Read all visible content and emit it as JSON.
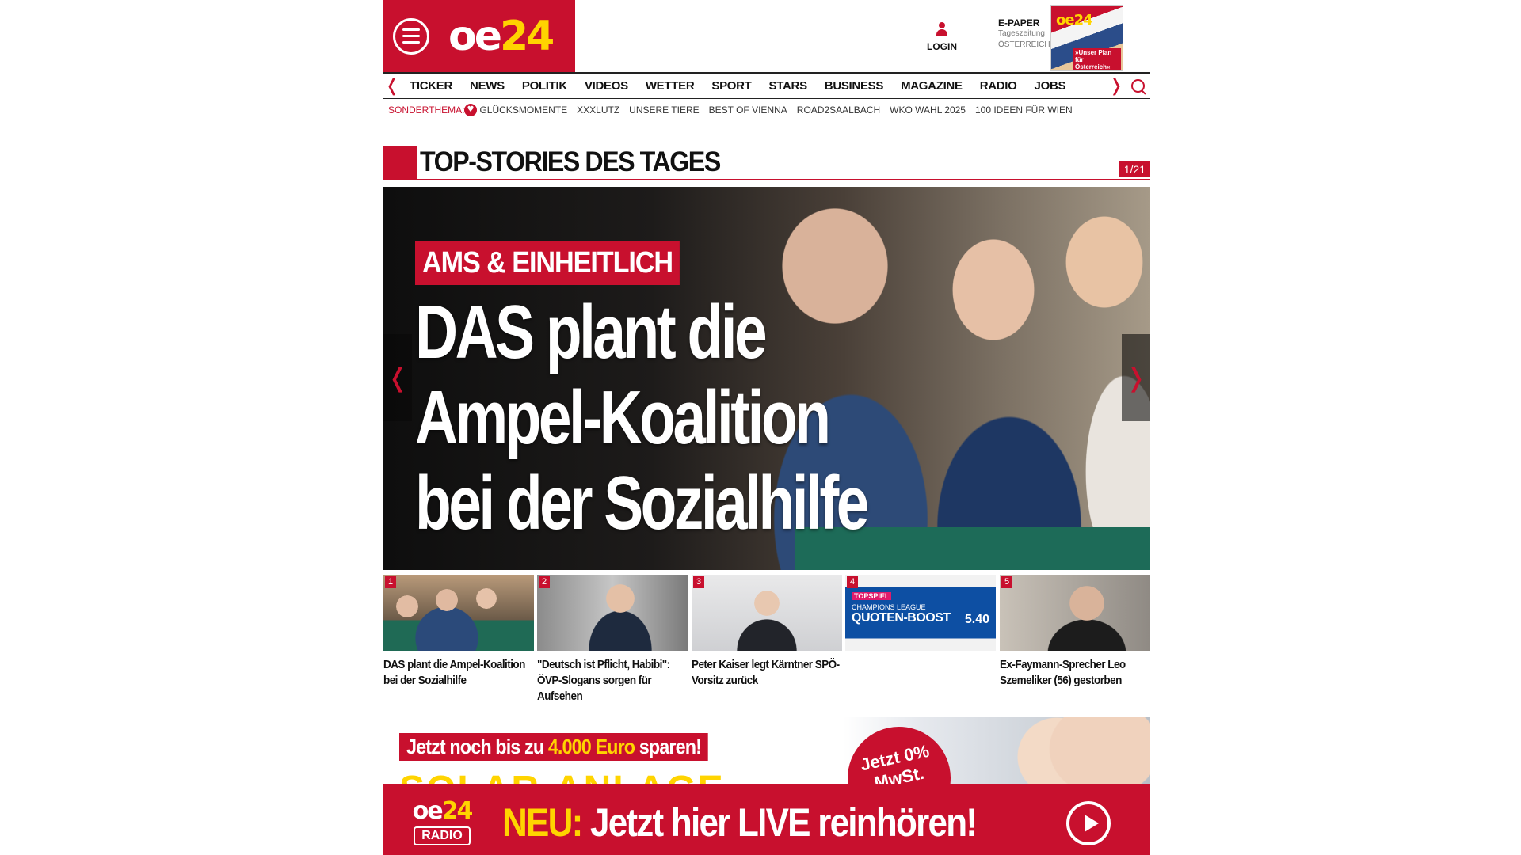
{
  "header": {
    "logo_oe": "oe",
    "logo_24": "24",
    "login": "LOGIN",
    "epaper_title": "E-PAPER",
    "epaper_sub1": "Tageszeitung",
    "epaper_sub2": "ÖSTERREICH",
    "epaper_thumb_logo": "oe24",
    "epaper_thumb_text": "»Unser Plan für Österreich«"
  },
  "nav": {
    "items": [
      "TICKER",
      "NEWS",
      "POLITIK",
      "VIDEOS",
      "WETTER",
      "SPORT",
      "STARS",
      "BUSINESS",
      "MAGAZINE",
      "RADIO",
      "JOBS"
    ],
    "prev_arrow": "❬",
    "next_arrow": "❭"
  },
  "subnav": {
    "label": "SONDERTHEMA:",
    "items": [
      "GLÜCKSMOMENTE",
      "XXXLUTZ",
      "UNSERE TIERE",
      "BEST OF VIENNA",
      "ROAD2SAALBACH",
      "WKO WAHL 2025",
      "100 IDEEN FÜR WIEN"
    ]
  },
  "section": {
    "title": "TOP-STORIES DES TAGES",
    "counter": "1/21"
  },
  "hero": {
    "kicker": "AMS & EINHEITLICH",
    "headline_1": "DAS plant die",
    "headline_2": "Ampel-Koalition",
    "headline_3": "bei der Sozialhilfe",
    "prev": "❬",
    "next": "❭"
  },
  "thumbs": [
    {
      "num": "1",
      "caption": "DAS plant die Ampel-Koalition bei der Sozialhilfe"
    },
    {
      "num": "2",
      "caption": "\"Deutsch ist Pflicht, Habibi\": ÖVP-Slogans sorgen für Aufsehen"
    },
    {
      "num": "3",
      "caption": "Peter Kaiser legt Kärntner SPÖ-Vorsitz zurück"
    },
    {
      "num": "4",
      "caption": "",
      "ad_a": "TOPSPIEL",
      "ad_b": "CHAMPIONS LEAGUE",
      "ad_c": "QUOTEN-BOOST",
      "ad_d": "5.40"
    },
    {
      "num": "5",
      "caption": "Ex-Faymann-Sprecher Leo Szemeliker (56) gestorben"
    }
  ],
  "ad": {
    "pill_a": "Jetzt noch bis zu ",
    "pill_b": "4.000 Euro",
    "pill_c": " sparen!",
    "badge": "Jetzt 0% MwSt.",
    "yellow": "SOLAR-ANLAGE"
  },
  "radio": {
    "logo_oe": "oe",
    "logo_24": "24",
    "logo_radio": "RADIO",
    "neu": "NEU:",
    "text": " Jetzt hier LIVE reinhören!"
  }
}
